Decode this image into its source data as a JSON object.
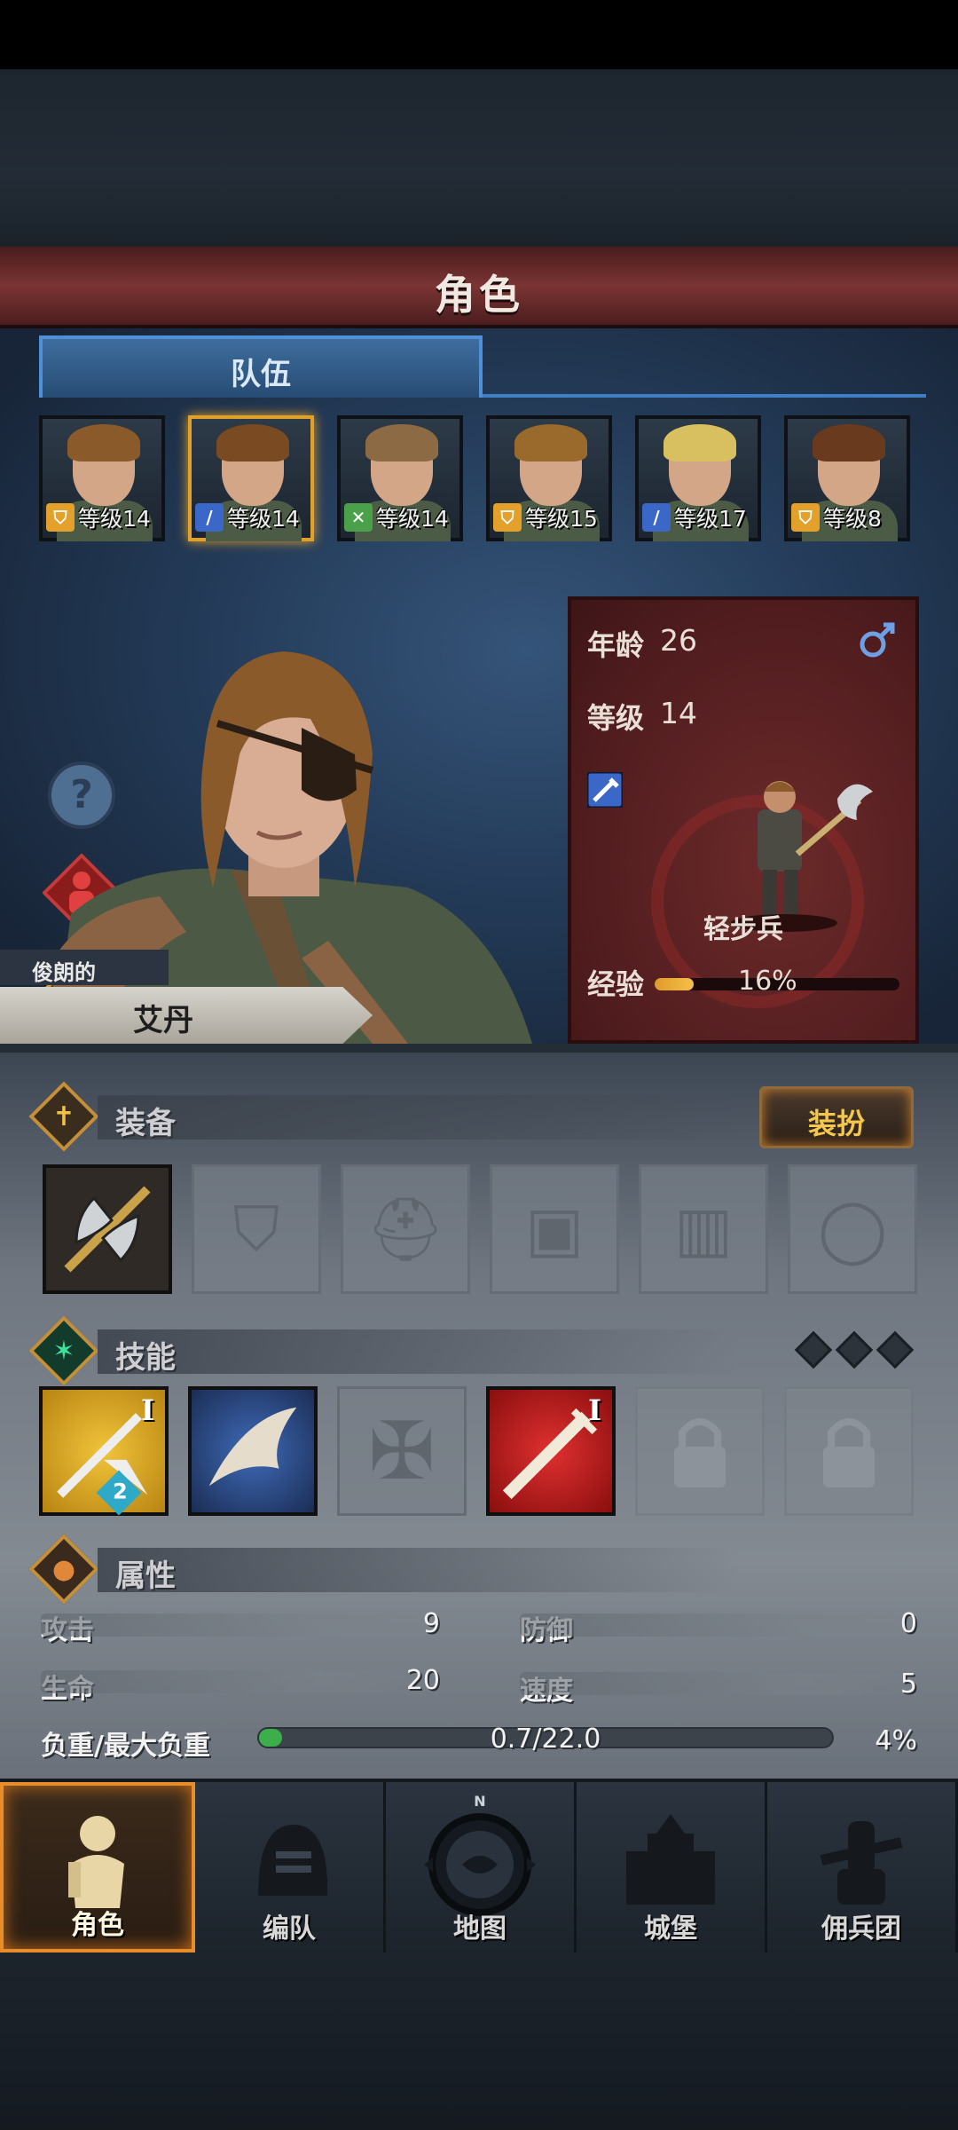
{
  "header": {
    "title": "角色"
  },
  "tabs": [
    {
      "label": "队伍",
      "active": true
    }
  ],
  "roster": [
    {
      "class_icon": "shield-icon",
      "class_color": "#e3a12b",
      "level": "等级14",
      "selected": false,
      "hair": "#8a5a2a"
    },
    {
      "class_icon": "sword-icon",
      "class_color": "#3a67c8",
      "level": "等级14",
      "selected": true,
      "hair": "#7a4a22"
    },
    {
      "class_icon": "cross-swords-icon",
      "class_color": "#4aa14a",
      "level": "等级14",
      "selected": false,
      "hair": "#8c6a44"
    },
    {
      "class_icon": "shield-icon",
      "class_color": "#e3a12b",
      "level": "等级15",
      "selected": false,
      "hair": "#9a6a2c"
    },
    {
      "class_icon": "sword-icon",
      "class_color": "#3a67c8",
      "level": "等级17",
      "selected": false,
      "hair": "#d8c060"
    },
    {
      "class_icon": "shield-icon",
      "class_color": "#e3a12b",
      "level": "等级8",
      "selected": false,
      "hair": "#6a3a1e"
    }
  ],
  "side_buttons": [
    "help-icon",
    "character-icon",
    "potion-icon"
  ],
  "hero": {
    "adjective": "俊朗的",
    "name": "艾丹"
  },
  "info": {
    "age_label": "年龄",
    "age": "26",
    "level_label": "等级",
    "level": "14",
    "gender_icon": "male-icon",
    "class_icon": "sword-icon",
    "unit_type": "轻步兵",
    "exp_label": "经验",
    "exp_percent": "16%",
    "exp_fraction": 0.16
  },
  "equipment": {
    "title": "装备",
    "dress_button": "装扮",
    "slots": [
      "axe-icon",
      "shield-slot-icon",
      "helmet-slot-icon",
      "armor-slot-icon",
      "boots-slot-icon",
      "ring-slot-icon"
    ]
  },
  "skills": {
    "title": "技能",
    "points": 3,
    "slots": [
      {
        "name": "sword-thrust-skill-icon",
        "tier": "I",
        "badge": "2"
      },
      {
        "name": "eagle-skill-icon"
      },
      {
        "name": "cross-skill-icon"
      },
      {
        "name": "blade-skill-icon",
        "tier": "I"
      },
      {
        "name": "lock-icon"
      },
      {
        "name": "lock-icon"
      }
    ]
  },
  "attributes": {
    "title": "属性",
    "attack_label": "攻击",
    "attack": "9",
    "defense_label": "防御",
    "defense": "0",
    "hp_label": "生命",
    "hp": "20",
    "speed_label": "速度",
    "speed": "5",
    "load_label": "负重/最大负重",
    "load_value": "0.7/22.0",
    "load_percent": "4%",
    "load_fraction": 0.04
  },
  "nav": [
    {
      "label": "角色",
      "icon": "knight-icon",
      "active": true
    },
    {
      "label": "编队",
      "icon": "helmet-icon",
      "active": false
    },
    {
      "label": "地图",
      "icon": "compass-icon",
      "compass_letter": "N",
      "active": false
    },
    {
      "label": "城堡",
      "icon": "castle-icon",
      "active": false
    },
    {
      "label": "佣兵团",
      "icon": "fist-icon",
      "active": false
    }
  ]
}
